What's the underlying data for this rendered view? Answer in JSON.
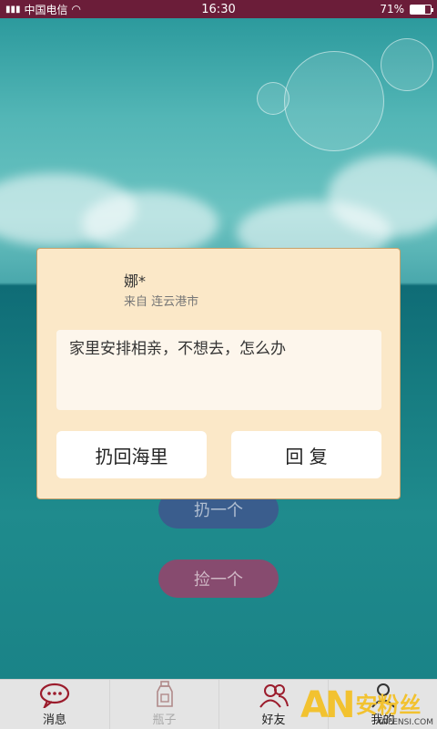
{
  "status_bar": {
    "carrier": "中国电信",
    "time": "16:30",
    "battery_percent": "71%",
    "battery_level": 0.71
  },
  "main": {
    "throw_button": "扔一个",
    "pick_button": "捡一个"
  },
  "dialog": {
    "sender_name": "娜*",
    "sender_location": "来自 连云港市",
    "message": "家里安排相亲，不想去，怎么办",
    "throw_back_button": "扔回海里",
    "reply_button": "回 复"
  },
  "tabbar": {
    "tabs": [
      {
        "label": "消息",
        "icon": "message-bubble-icon"
      },
      {
        "label": "瓶子",
        "icon": "bottle-icon"
      },
      {
        "label": "好友",
        "icon": "friends-icon"
      },
      {
        "label": "我的",
        "icon": "profile-icon"
      }
    ]
  },
  "watermark": {
    "logo": "AN",
    "text": "安粉丝",
    "sub": "ANFENSI.COM"
  },
  "colors": {
    "status_bar": "#6b1d39",
    "dialog_bg": "#fbe8c8",
    "accent_red": "#9b1c2c"
  }
}
